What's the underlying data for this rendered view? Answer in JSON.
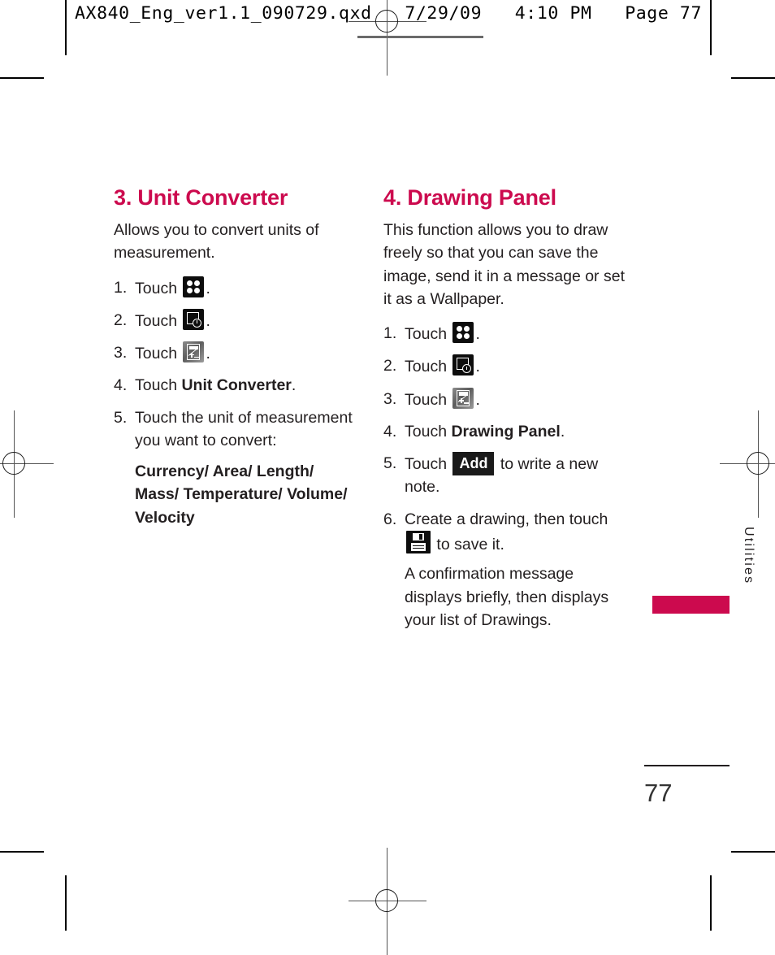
{
  "prepress": {
    "header_line": "AX840_Eng_ver1.1_090729.qxd   7/29/09   4:10 PM   Page 77"
  },
  "theme": {
    "heading_color": "#CC0A4E",
    "tab_color": "#CC0A4E",
    "text_color": "#231f20"
  },
  "sections": {
    "unit_converter": {
      "title": "3. Unit Converter",
      "intro": "Allows you to convert units of measurement.",
      "steps": [
        {
          "num": "1.",
          "pre": "Touch ",
          "icon": "menu-icon",
          "post": "."
        },
        {
          "num": "2.",
          "pre": "Touch ",
          "icon": "tools-icon",
          "post": "."
        },
        {
          "num": "3.",
          "pre": "Touch ",
          "icon": "calculator-icon",
          "post": "."
        },
        {
          "num": "4.",
          "pre": "Touch ",
          "bold": "Unit Converter",
          "post": "."
        },
        {
          "num": "5.",
          "pre": "Touch the unit of measurement you want to convert:"
        }
      ],
      "unit_list": "Currency/ Area/ Length/ Mass/ Temperature/ Volume/ Velocity"
    },
    "drawing_panel": {
      "title": "4. Drawing Panel",
      "intro": "This function allows you to draw freely so that you can save the image, send it in a message or set it as a Wallpaper.",
      "steps": [
        {
          "num": "1.",
          "pre": "Touch ",
          "icon": "menu-icon",
          "post": "."
        },
        {
          "num": "2.",
          "pre": "Touch ",
          "icon": "tools-icon",
          "post": "."
        },
        {
          "num": "3.",
          "pre": "Touch ",
          "icon": "calculator-icon",
          "post": "."
        },
        {
          "num": "4.",
          "pre": "Touch ",
          "bold": "Drawing Panel",
          "post": "."
        },
        {
          "num": "5.",
          "pre": "Touch ",
          "key": "Add",
          "post": " to write a new note."
        },
        {
          "num": "6.",
          "pre": "Create a drawing, then touch ",
          "icon": "save-icon",
          "post": " to save it."
        }
      ],
      "confirmation": "A confirmation message displays briefly, then displays your list of Drawings."
    }
  },
  "side_tab": {
    "label": "Utilities"
  },
  "footer": {
    "page_number": "77"
  }
}
